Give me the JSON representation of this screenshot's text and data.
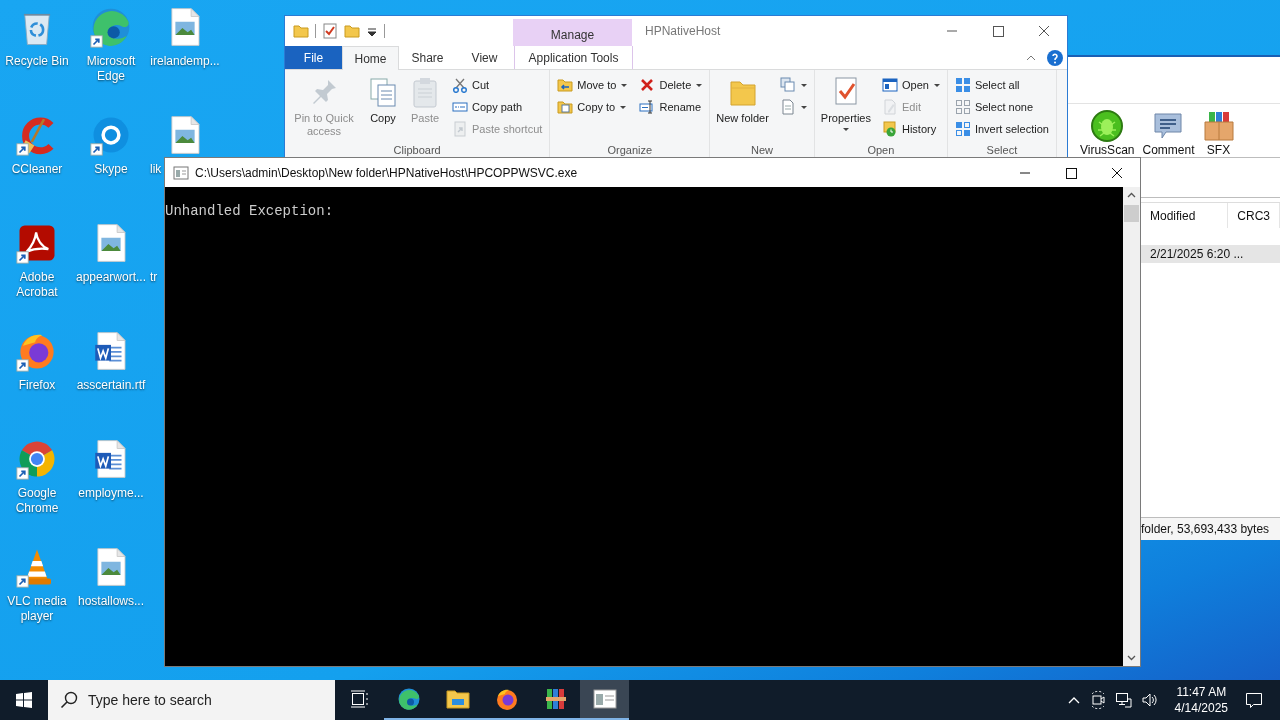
{
  "desktop_icons": [
    {
      "label": "Recycle Bin",
      "kind": "recycle",
      "shortcut": false
    },
    {
      "label": "CCleaner",
      "kind": "ccleaner",
      "shortcut": true
    },
    {
      "label": "Adobe Acrobat",
      "kind": "acrobat",
      "shortcut": true
    },
    {
      "label": "Firefox",
      "kind": "firefox",
      "shortcut": true
    },
    {
      "label": "Google Chrome",
      "kind": "chrome",
      "shortcut": true
    },
    {
      "label": "VLC media player",
      "kind": "vlc",
      "shortcut": true
    },
    {
      "label": "Microsoft Edge",
      "kind": "edge",
      "shortcut": true
    },
    {
      "label": "Skype",
      "kind": "skype",
      "shortcut": true
    },
    {
      "label": "appearwort...",
      "kind": "image",
      "shortcut": false
    },
    {
      "label": "asscertain.rtf",
      "kind": "word",
      "shortcut": false
    },
    {
      "label": "employme...",
      "kind": "word",
      "shortcut": false
    },
    {
      "label": "hostallows...",
      "kind": "image",
      "shortcut": false
    },
    {
      "label": "irelandemp...",
      "kind": "image",
      "shortcut": false
    },
    {
      "label": "lik",
      "kind": "image",
      "shortcut": false,
      "clipped": true
    },
    {
      "label": "tr",
      "clipped": true
    }
  ],
  "archiver": {
    "toolbar": [
      {
        "label": "VirusScan",
        "kind": "virus"
      },
      {
        "label": "Comment",
        "kind": "comment"
      },
      {
        "label": "SFX",
        "kind": "sfx"
      }
    ],
    "columns": [
      "Modified",
      "CRC3"
    ],
    "rows": [
      {
        "cells": [
          "2/21/2025 6:20 ..."
        ],
        "selected": true
      }
    ],
    "status": "folder, 53,693,433 bytes"
  },
  "explorer": {
    "title": "HPNativeHost",
    "context_header": "Manage",
    "tabs": [
      {
        "label": "File",
        "kind": "file",
        "selected": false
      },
      {
        "label": "Home",
        "kind": "plain",
        "selected": true
      },
      {
        "label": "Share",
        "kind": "plain",
        "selected": false
      },
      {
        "label": "View",
        "kind": "plain",
        "selected": false
      },
      {
        "label": "Application Tools",
        "kind": "context",
        "selected": false
      }
    ],
    "groups": [
      {
        "label": "Clipboard",
        "columns": [
          [
            {
              "kind": "large",
              "label": "Pin to Quick access",
              "disabled": true
            }
          ],
          [
            {
              "kind": "large",
              "label": "Copy",
              "disabled": false
            }
          ],
          [
            {
              "kind": "large",
              "label": "Paste",
              "disabled": true
            }
          ],
          [
            {
              "kind": "small",
              "label": "Cut",
              "disabled": false
            },
            {
              "kind": "small",
              "label": "Copy path",
              "disabled": false
            },
            {
              "kind": "small",
              "label": "Paste shortcut",
              "disabled": true
            }
          ]
        ]
      },
      {
        "label": "Organize",
        "columns": [
          [
            {
              "kind": "small",
              "label": "Move to",
              "dropdown": true,
              "disabled": false
            },
            {
              "kind": "small",
              "label": "Copy to",
              "dropdown": true,
              "disabled": false
            }
          ],
          [
            {
              "kind": "small",
              "label": "Delete",
              "dropdown": true,
              "disabled": false
            },
            {
              "kind": "small",
              "label": "Rename",
              "disabled": false
            }
          ]
        ]
      },
      {
        "label": "New",
        "columns": [
          [
            {
              "kind": "large",
              "label": "New folder",
              "disabled": false
            }
          ],
          [
            {
              "kind": "small",
              "dropdown": true,
              "disabled": false
            },
            {
              "kind": "small",
              "dropdown": true,
              "disabled": false
            }
          ]
        ]
      },
      {
        "label": "Open",
        "columns": [
          [
            {
              "kind": "large",
              "label": "Properties",
              "dropdown": true,
              "disabled": false
            }
          ],
          [
            {
              "kind": "small",
              "label": "Open",
              "dropdown": true,
              "disabled": false
            },
            {
              "kind": "small",
              "label": "Edit",
              "disabled": true
            },
            {
              "kind": "small",
              "label": "History",
              "disabled": false
            }
          ]
        ]
      },
      {
        "label": "Select",
        "columns": [
          [
            {
              "kind": "small",
              "label": "Select all",
              "disabled": false
            },
            {
              "kind": "small",
              "label": "Select none",
              "disabled": false
            },
            {
              "kind": "small",
              "label": "Invert selection",
              "disabled": false
            }
          ]
        ]
      }
    ]
  },
  "console": {
    "title": "C:\\Users\\admin\\Desktop\\New folder\\HPNativeHost\\HPCOPPWSVC.exe",
    "lines": [
      "Unhandled Exception:"
    ]
  },
  "taskbar": {
    "search": {
      "placeholder": "Type here to search"
    },
    "apps": [
      {
        "kind": "edge",
        "open": true,
        "selected": false
      },
      {
        "kind": "explorer",
        "open": true,
        "selected": false
      },
      {
        "kind": "firefox",
        "open": true,
        "selected": false
      },
      {
        "kind": "archiver",
        "open": true,
        "selected": false
      },
      {
        "kind": "console",
        "open": true,
        "selected": true
      }
    ],
    "clock": {
      "time": "11:47 AM",
      "date": "4/14/2025"
    }
  }
}
